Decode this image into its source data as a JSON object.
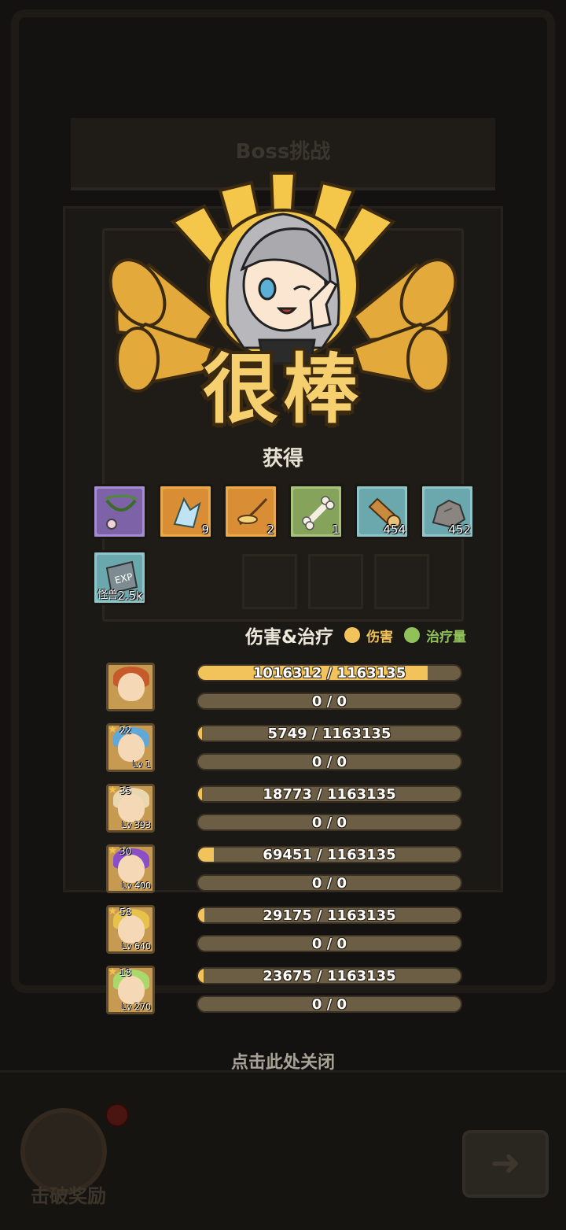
{
  "background": {
    "title": "Boss挑战",
    "kill_reward_label": "击破奖励"
  },
  "result": {
    "banner_text": "很棒"
  },
  "rewards": {
    "title": "获得",
    "items": [
      {
        "icon": "vine-necklace-icon",
        "qty": ""
      },
      {
        "icon": "crystal-shard-icon",
        "qty": "9"
      },
      {
        "icon": "root-icon",
        "qty": "2"
      },
      {
        "icon": "bone-icon",
        "qty": "1"
      },
      {
        "icon": "wood-log-icon",
        "qty": "454"
      },
      {
        "icon": "stone-icon",
        "qty": "452"
      },
      {
        "icon": "exp-book-icon",
        "qty": "2.5k",
        "sub": "怪兽"
      }
    ]
  },
  "stats": {
    "title": "伤害&治疗",
    "legend_damage": "伤害",
    "legend_heal": "治疗量",
    "colors": {
      "damage": "#f1c35a",
      "heal": "#8fc35a",
      "bar_bg": "#6c5e45"
    },
    "heroes": [
      {
        "stars": "",
        "level": "",
        "damage": 1016312,
        "damage_max": 1163135,
        "damage_text": "1016312 / 1163135",
        "heal_text": "0 / 0",
        "hair": "#c65a2a"
      },
      {
        "stars": "22",
        "level": "Lv 1",
        "damage": 5749,
        "damage_max": 1163135,
        "damage_text": "5749 / 1163135",
        "heal_text": "0 / 0",
        "hair": "#5fa8d8"
      },
      {
        "stars": "35",
        "level": "Lv 393",
        "damage": 18773,
        "damage_max": 1163135,
        "damage_text": "18773 / 1163135",
        "heal_text": "0 / 0",
        "hair": "#e9d7b0"
      },
      {
        "stars": "30",
        "level": "Lv 400",
        "damage": 69451,
        "damage_max": 1163135,
        "damage_text": "69451 / 1163135",
        "heal_text": "0 / 0",
        "hair": "#8a4fc8"
      },
      {
        "stars": "58",
        "level": "Lv 640",
        "damage": 29175,
        "damage_max": 1163135,
        "damage_text": "29175 / 1163135",
        "heal_text": "0 / 0",
        "hair": "#e7c24a"
      },
      {
        "stars": "18",
        "level": "Lv 270",
        "damage": 23675,
        "damage_max": 1163135,
        "damage_text": "23675 / 1163135",
        "heal_text": "0 / 0",
        "hair": "#a9d96a"
      }
    ]
  },
  "close_hint": "点击此处关闭"
}
